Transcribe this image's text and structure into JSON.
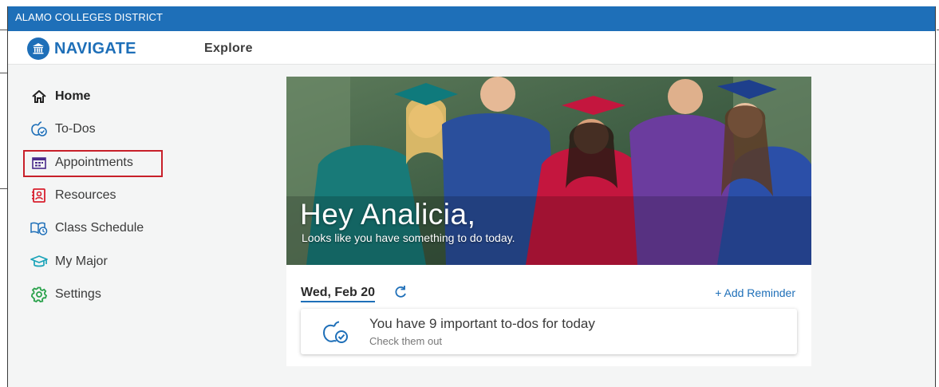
{
  "topbar": {
    "org": "ALAMO COLLEGES DISTRICT"
  },
  "navbar": {
    "brand": "NAVIGATE",
    "explore": "Explore"
  },
  "sidebar": {
    "items": [
      {
        "label": "Home",
        "icon": "home-icon"
      },
      {
        "label": "To-Dos",
        "icon": "apple-check-icon"
      },
      {
        "label": "Appointments",
        "icon": "calendar-icon"
      },
      {
        "label": "Resources",
        "icon": "contact-card-icon"
      },
      {
        "label": "Class Schedule",
        "icon": "book-clock-icon"
      },
      {
        "label": "My Major",
        "icon": "graduation-cap-icon"
      },
      {
        "label": "Settings",
        "icon": "gear-icon"
      }
    ],
    "highlighted": "Appointments"
  },
  "hero": {
    "greeting": "Hey Analicia,",
    "message": "Looks like you have something to do today."
  },
  "today": {
    "date": "Wed, Feb 20",
    "add_reminder": "+ Add Reminder",
    "todo_title": "You have 9 important to-dos for today",
    "todo_sub": "Check them out"
  },
  "colors": {
    "brand_blue": "#1e6fb8",
    "highlight_red": "#c8202a",
    "icon_green": "#2ba24c",
    "icon_teal": "#1aa3b8",
    "icon_red": "#d8202e"
  }
}
